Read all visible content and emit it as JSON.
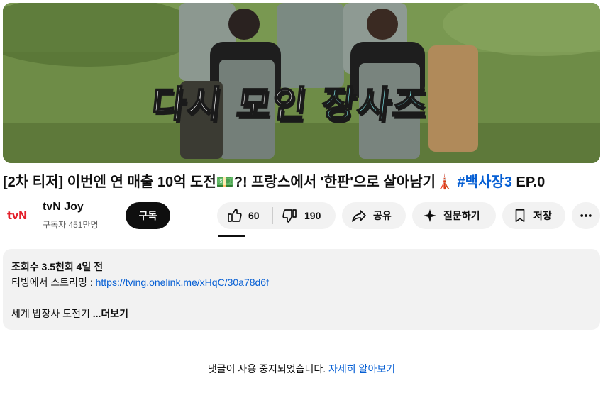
{
  "thumbnail": {
    "caption_white": "다시 모인",
    "caption_cyan": "장사즈"
  },
  "video": {
    "title_main": "[2차 티저] 이번엔 연 매출 10억 도전💵?! 프랑스에서 '한판'으로 살아남기🗼",
    "title_hashtag": "#백사장3",
    "title_tail": " EP.0"
  },
  "channel": {
    "logo_text": "tvN",
    "name": "tvN Joy",
    "subscribers": "구독자 451만명",
    "subscribe_label": "구독"
  },
  "actions": {
    "like_count": "60",
    "dislike_count": "190",
    "share_label": "공유",
    "ask_label": "질문하기",
    "save_label": "저장",
    "more_icon": "ellipsis-icon"
  },
  "description": {
    "stats": "조회수 3.5천회  4일 전",
    "stream_prefix": "티빙에서 스트리밍 : ",
    "stream_link": "https://tving.onelink.me/xHqC/30a78d6f",
    "snippet": "세계 밥장사 도전기",
    "more_label": " ...더보기"
  },
  "comments": {
    "disabled_text": "댓글이 사용 중지되었습니다. ",
    "learn_more": "자세히 알아보기"
  },
  "colors": {
    "link": "#065fd4",
    "pill_bg": "#f2f2f2",
    "subscribe_bg": "#0f0f0f",
    "logo_red": "#e4202b",
    "caption_cyan": "#7fe3e6"
  }
}
